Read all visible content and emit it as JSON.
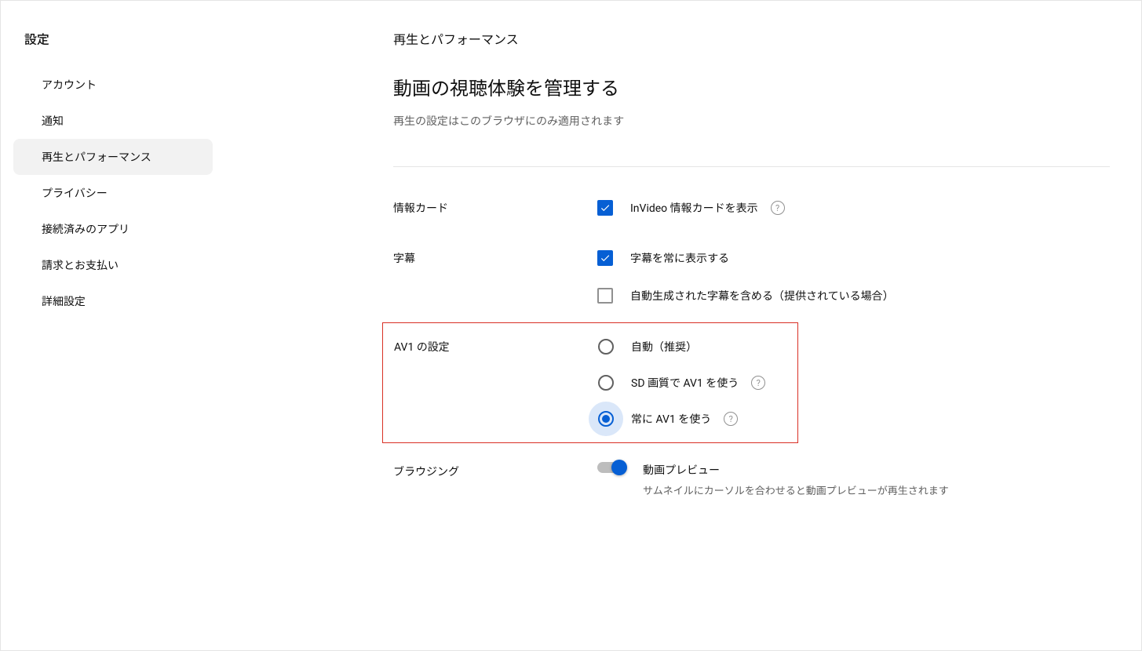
{
  "sidebar": {
    "title": "設定",
    "items": [
      {
        "label": "アカウント",
        "active": false
      },
      {
        "label": "通知",
        "active": false
      },
      {
        "label": "再生とパフォーマンス",
        "active": true
      },
      {
        "label": "プライバシー",
        "active": false
      },
      {
        "label": "接続済みのアプリ",
        "active": false
      },
      {
        "label": "請求とお支払い",
        "active": false
      },
      {
        "label": "詳細設定",
        "active": false
      }
    ]
  },
  "main": {
    "crumb": "再生とパフォーマンス",
    "heading": "動画の視聴体験を管理する",
    "sub": "再生の設定はこのブラウザにのみ適用されます",
    "sections": {
      "info_card": {
        "label": "情報カード",
        "option": "InVideo 情報カードを表示"
      },
      "subtitles": {
        "label": "字幕",
        "always": "字幕を常に表示する",
        "auto": "自動生成された字幕を含める（提供されている場合）"
      },
      "av1": {
        "label": "AV1 の設定",
        "auto": "自動（推奨）",
        "sd": "SD 画質で AV1 を使う",
        "always": "常に AV1 を使う"
      },
      "browsing": {
        "label": "ブラウジング",
        "preview_title": "動画プレビュー",
        "preview_desc": "サムネイルにカーソルを合わせると動画プレビューが再生されます"
      }
    }
  },
  "help_glyph": "?"
}
